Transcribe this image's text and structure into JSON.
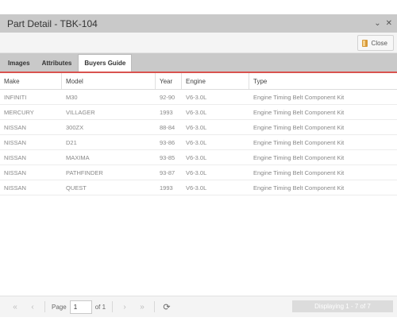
{
  "window": {
    "title": "Part Detail - TBK-104",
    "minimize_glyph": "⌄",
    "close_glyph": "✕"
  },
  "toolbar": {
    "close_label": "Close",
    "close_icon": "door-icon"
  },
  "tabs": [
    {
      "label": "Images",
      "active": false
    },
    {
      "label": "Attributes",
      "active": false
    },
    {
      "label": "Buyers Guide",
      "active": true
    }
  ],
  "grid": {
    "columns": [
      "Make",
      "Model",
      "Year",
      "Engine",
      "Type"
    ],
    "rows": [
      [
        "INFINITI",
        "M30",
        "92-90",
        "V6-3.0L",
        "Engine Timing Belt Component Kit"
      ],
      [
        "MERCURY",
        "VILLAGER",
        "1993",
        "V6-3.0L",
        "Engine Timing Belt Component Kit"
      ],
      [
        "NISSAN",
        "300ZX",
        "88-84",
        "V6-3.0L",
        "Engine Timing Belt Component Kit"
      ],
      [
        "NISSAN",
        "D21",
        "93-86",
        "V6-3.0L",
        "Engine Timing Belt Component Kit"
      ],
      [
        "NISSAN",
        "MAXIMA",
        "93-85",
        "V6-3.0L",
        "Engine Timing Belt Component Kit"
      ],
      [
        "NISSAN",
        "PATHFINDER",
        "93-87",
        "V6-3.0L",
        "Engine Timing Belt Component Kit"
      ],
      [
        "NISSAN",
        "QUEST",
        "1993",
        "V6-3.0L",
        "Engine Timing Belt Component Kit"
      ]
    ]
  },
  "pager": {
    "page_label": "Page",
    "page_value": "1",
    "of_label": "of 1",
    "status": "Displaying 1 - 7 of 7",
    "icons": [
      "first-page-icon",
      "prev-page-icon",
      "next-page-icon",
      "last-page-icon",
      "refresh-icon"
    ]
  },
  "colors": {
    "accent_line": "#d9534f",
    "titlebar": "#c9c9c9"
  }
}
